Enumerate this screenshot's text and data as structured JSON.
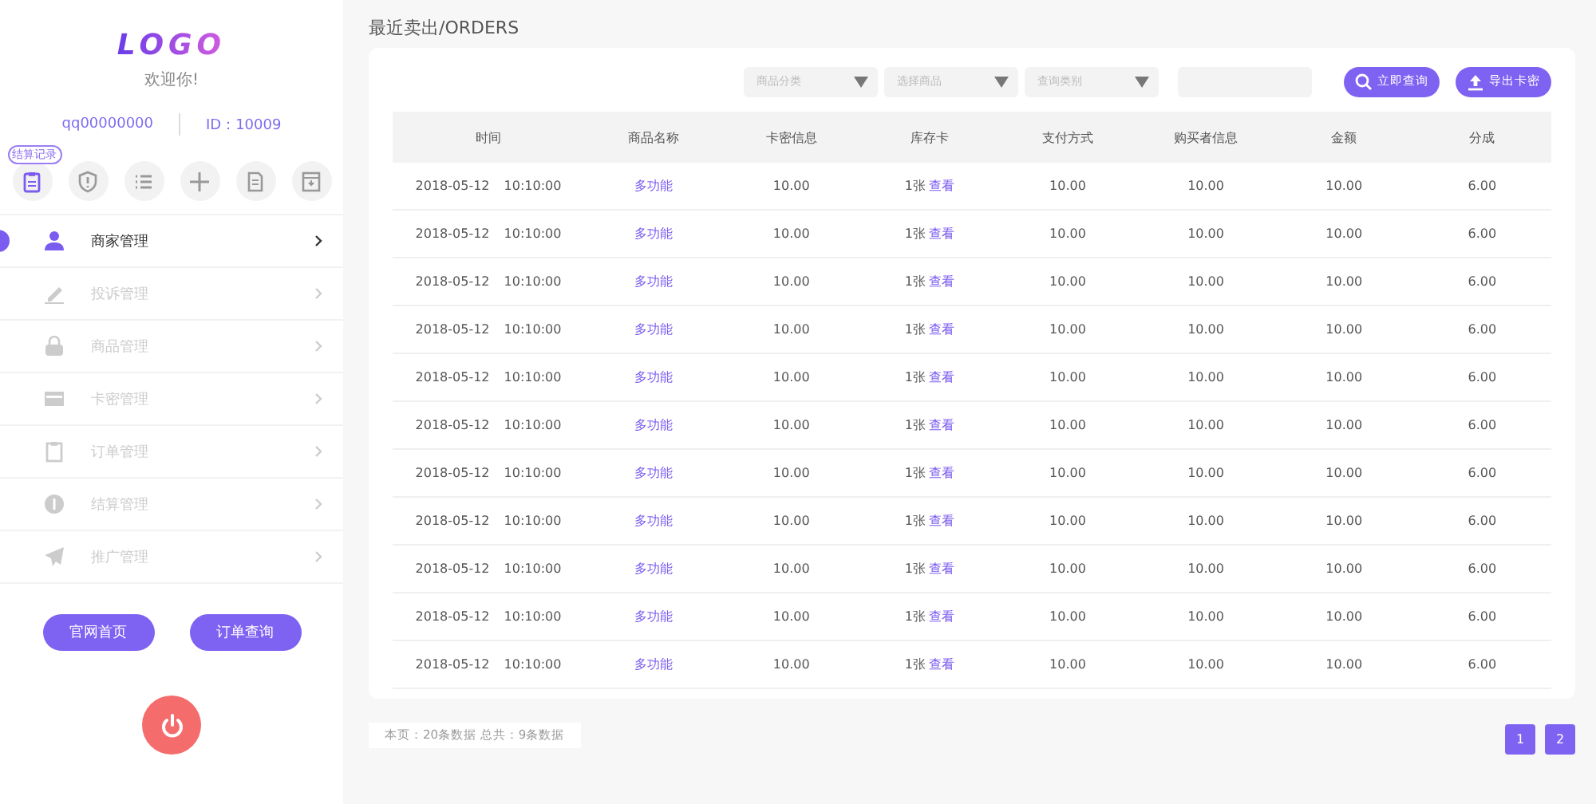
{
  "sidebar": {
    "logo": "LOGO",
    "welcome": "欢迎你!",
    "account": "qq00000000",
    "user_id": "ID：10009",
    "quick_icons": [
      {
        "kind": "clipboard",
        "badge": "结算记录"
      },
      {
        "kind": "shield"
      },
      {
        "kind": "list"
      },
      {
        "kind": "plus"
      },
      {
        "kind": "document"
      },
      {
        "kind": "archive"
      }
    ],
    "nav": [
      {
        "label": "商家管理",
        "selected": true
      },
      {
        "label": "投诉管理",
        "selected": false
      },
      {
        "label": "商品管理",
        "selected": false
      },
      {
        "label": "卡密管理",
        "selected": false
      },
      {
        "label": "订单管理",
        "selected": false
      },
      {
        "label": "结算管理",
        "selected": false
      },
      {
        "label": "推广管理",
        "selected": false
      }
    ],
    "buttons": [
      "官网首页",
      "订单查询"
    ]
  },
  "page_title": "最近卖出/ORDERS",
  "filters": {
    "selects": [
      {
        "placeholder": "商品分类"
      },
      {
        "placeholder": "选择商品"
      },
      {
        "placeholder": "查询类别"
      }
    ],
    "search_button": "立即查询",
    "export_button": "导出卡密"
  },
  "table": {
    "columns": [
      "时间",
      "商品名称",
      "卡密信息",
      "库存卡",
      "支付方式",
      "购买者信息",
      "金额",
      "分成"
    ],
    "rows": [
      {
        "date": "2018-05-12",
        "time": "10:10:00",
        "product": "多功能",
        "card_info": "10.00",
        "stock": "1张",
        "stock_link": "查看",
        "payment": "10.00",
        "buyer": "10.00",
        "amount": "10.00",
        "share": "6.00"
      },
      {
        "date": "2018-05-12",
        "time": "10:10:00",
        "product": "多功能",
        "card_info": "10.00",
        "stock": "1张",
        "stock_link": "查看",
        "payment": "10.00",
        "buyer": "10.00",
        "amount": "10.00",
        "share": "6.00"
      },
      {
        "date": "2018-05-12",
        "time": "10:10:00",
        "product": "多功能",
        "card_info": "10.00",
        "stock": "1张",
        "stock_link": "查看",
        "payment": "10.00",
        "buyer": "10.00",
        "amount": "10.00",
        "share": "6.00"
      },
      {
        "date": "2018-05-12",
        "time": "10:10:00",
        "product": "多功能",
        "card_info": "10.00",
        "stock": "1张",
        "stock_link": "查看",
        "payment": "10.00",
        "buyer": "10.00",
        "amount": "10.00",
        "share": "6.00"
      },
      {
        "date": "2018-05-12",
        "time": "10:10:00",
        "product": "多功能",
        "card_info": "10.00",
        "stock": "1张",
        "stock_link": "查看",
        "payment": "10.00",
        "buyer": "10.00",
        "amount": "10.00",
        "share": "6.00"
      },
      {
        "date": "2018-05-12",
        "time": "10:10:00",
        "product": "多功能",
        "card_info": "10.00",
        "stock": "1张",
        "stock_link": "查看",
        "payment": "10.00",
        "buyer": "10.00",
        "amount": "10.00",
        "share": "6.00"
      },
      {
        "date": "2018-05-12",
        "time": "10:10:00",
        "product": "多功能",
        "card_info": "10.00",
        "stock": "1张",
        "stock_link": "查看",
        "payment": "10.00",
        "buyer": "10.00",
        "amount": "10.00",
        "share": "6.00"
      },
      {
        "date": "2018-05-12",
        "time": "10:10:00",
        "product": "多功能",
        "card_info": "10.00",
        "stock": "1张",
        "stock_link": "查看",
        "payment": "10.00",
        "buyer": "10.00",
        "amount": "10.00",
        "share": "6.00"
      },
      {
        "date": "2018-05-12",
        "time": "10:10:00",
        "product": "多功能",
        "card_info": "10.00",
        "stock": "1张",
        "stock_link": "查看",
        "payment": "10.00",
        "buyer": "10.00",
        "amount": "10.00",
        "share": "6.00"
      },
      {
        "date": "2018-05-12",
        "time": "10:10:00",
        "product": "多功能",
        "card_info": "10.00",
        "stock": "1张",
        "stock_link": "查看",
        "payment": "10.00",
        "buyer": "10.00",
        "amount": "10.00",
        "share": "6.00"
      },
      {
        "date": "2018-05-12",
        "time": "10:10:00",
        "product": "多功能",
        "card_info": "10.00",
        "stock": "1张",
        "stock_link": "查看",
        "payment": "10.00",
        "buyer": "10.00",
        "amount": "10.00",
        "share": "6.00"
      }
    ]
  },
  "footer": {
    "summary": "本页：20条数据  总共：9条数据",
    "pages": [
      "1",
      "2"
    ]
  }
}
